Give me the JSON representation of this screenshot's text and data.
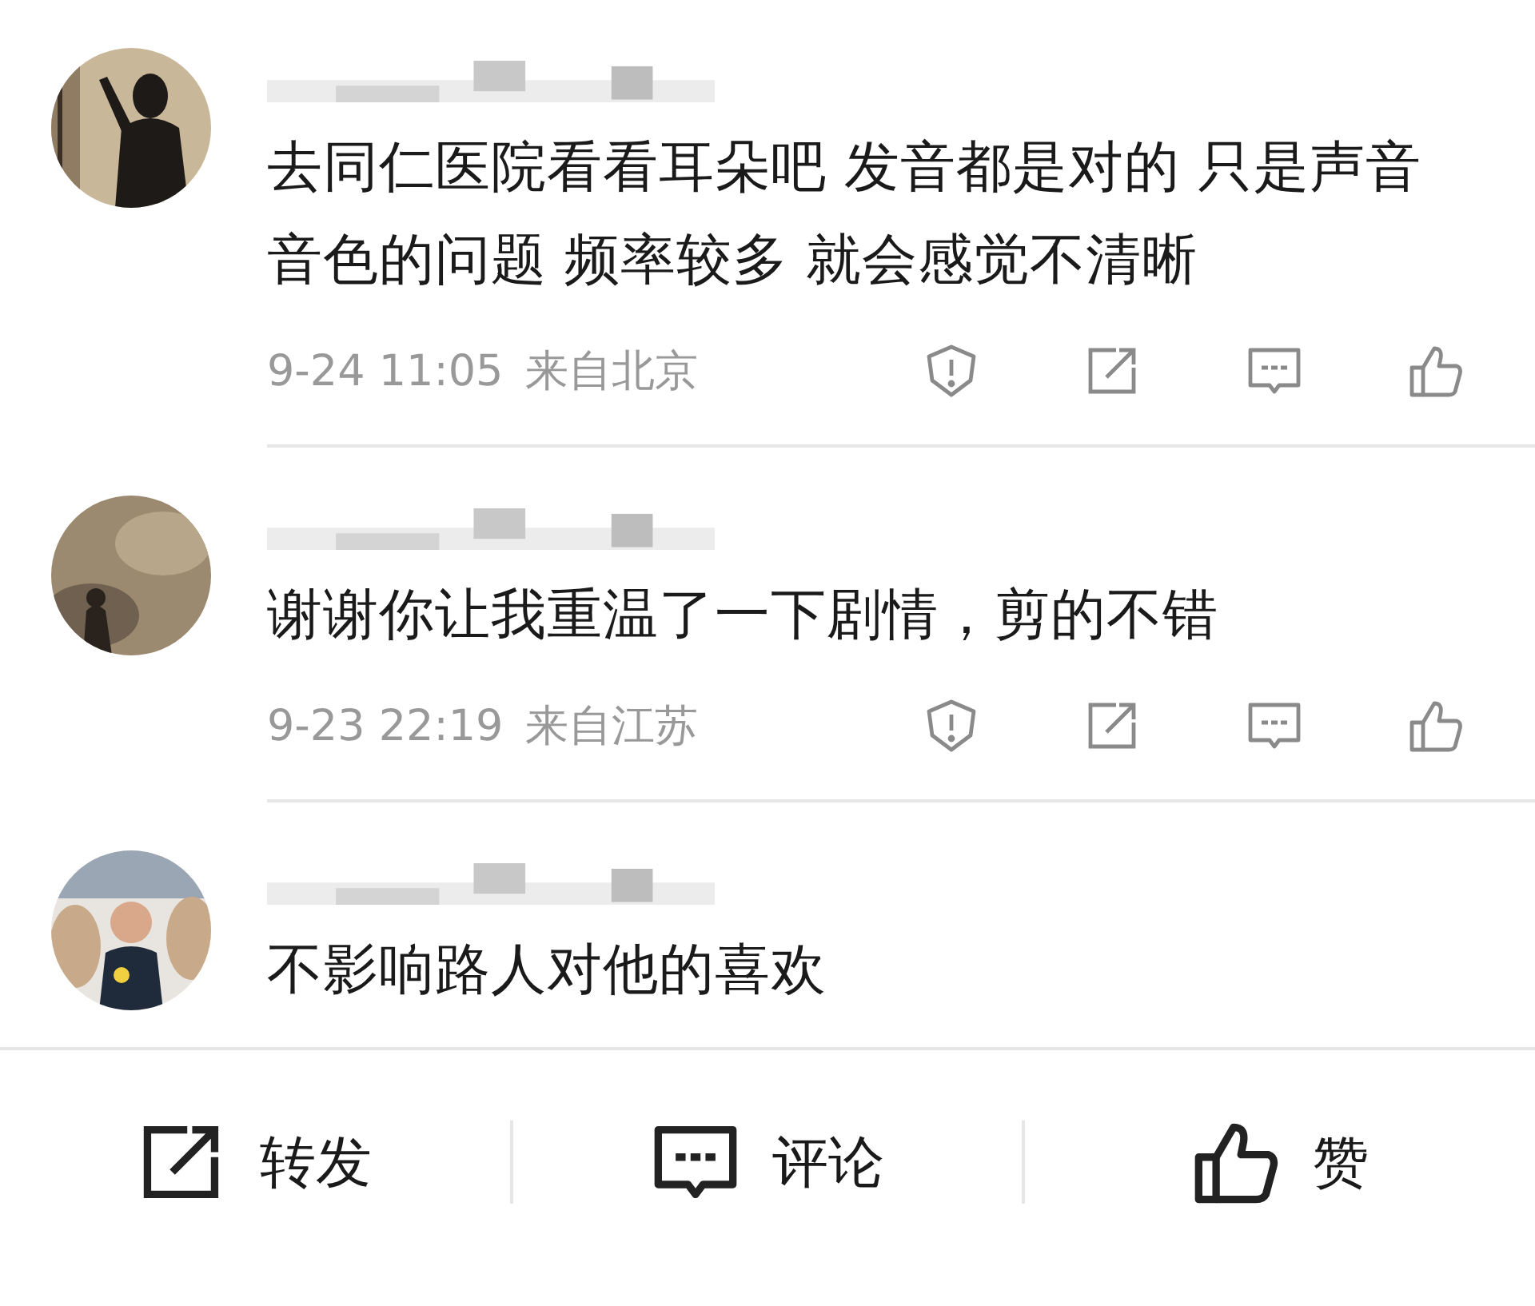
{
  "comments": [
    {
      "text": "去同仁医院看看耳朵吧 发音都是对的 只是声音音色的问题 频率较多 就会感觉不清晰",
      "time": "9-24 11:05",
      "location": "来自北京"
    },
    {
      "text": "谢谢你让我重温了一下剧情，剪的不错",
      "time": "9-23 22:19",
      "location": "来自江苏"
    },
    {
      "text": "不影响路人对他的喜欢"
    }
  ],
  "bottom_bar": [
    {
      "kind": "repost",
      "label": "转发"
    },
    {
      "kind": "comment",
      "label": "评论"
    },
    {
      "kind": "like",
      "label": "赞"
    }
  ]
}
